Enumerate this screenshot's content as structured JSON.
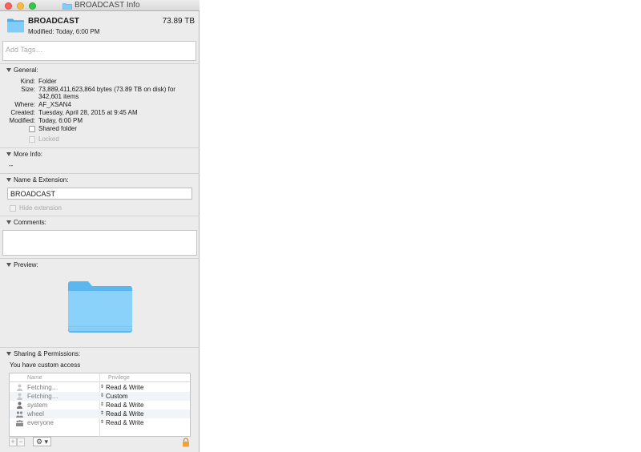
{
  "window": {
    "title": "BROADCAST Info"
  },
  "header": {
    "name": "BROADCAST",
    "size": "73.89 TB",
    "modified": "Modified: Today, 6:00 PM"
  },
  "tags": {
    "placeholder": "Add Tags…"
  },
  "general": {
    "heading": "General:",
    "rows": [
      {
        "key": "Kind:",
        "value": "Folder"
      },
      {
        "key": "Size:",
        "value": "73,889,411,623,864 bytes (73.89 TB on disk) for",
        "value2": "342,601 items"
      },
      {
        "key": "Where:",
        "value": "AF_XSAN4"
      },
      {
        "key": "Created:",
        "value": "Tuesday, April 28, 2015 at 9:45 AM"
      },
      {
        "key": "Modified:",
        "value": "Today, 6:00 PM"
      }
    ],
    "shared_folder_label": "Shared folder",
    "locked_label": "Locked"
  },
  "more_info": {
    "heading": "More Info:",
    "value": "--"
  },
  "name_ext": {
    "heading": "Name & Extension:",
    "name_value": "BROADCAST",
    "hide_ext_label": "Hide extension"
  },
  "comments": {
    "heading": "Comments:"
  },
  "preview": {
    "heading": "Preview:"
  },
  "sharing": {
    "heading": "Sharing & Permissions:",
    "access_note": "You have custom access",
    "col_name": "Name",
    "col_privilege": "Privilege",
    "rows": [
      {
        "name": "Fetching…",
        "privilege": "Read & Write",
        "icon": "user-icon"
      },
      {
        "name": "Fetching…",
        "privilege": "Custom",
        "icon": "user-icon"
      },
      {
        "name": "system",
        "privilege": "Read & Write",
        "icon": "user-icon"
      },
      {
        "name": "wheel",
        "privilege": "Read & Write",
        "icon": "group-icon"
      },
      {
        "name": "everyone",
        "privilege": "Read & Write",
        "icon": "everyone-icon"
      }
    ],
    "add": "+",
    "remove": "−",
    "gear": "⚙ ▾"
  },
  "colors": {
    "folder_light": "#7fcdf8",
    "folder_dark": "#4aa9e8",
    "close": "#fc605b",
    "minimize": "#fdbc40",
    "zoom": "#34c84a",
    "lock": "#e8a53a"
  }
}
